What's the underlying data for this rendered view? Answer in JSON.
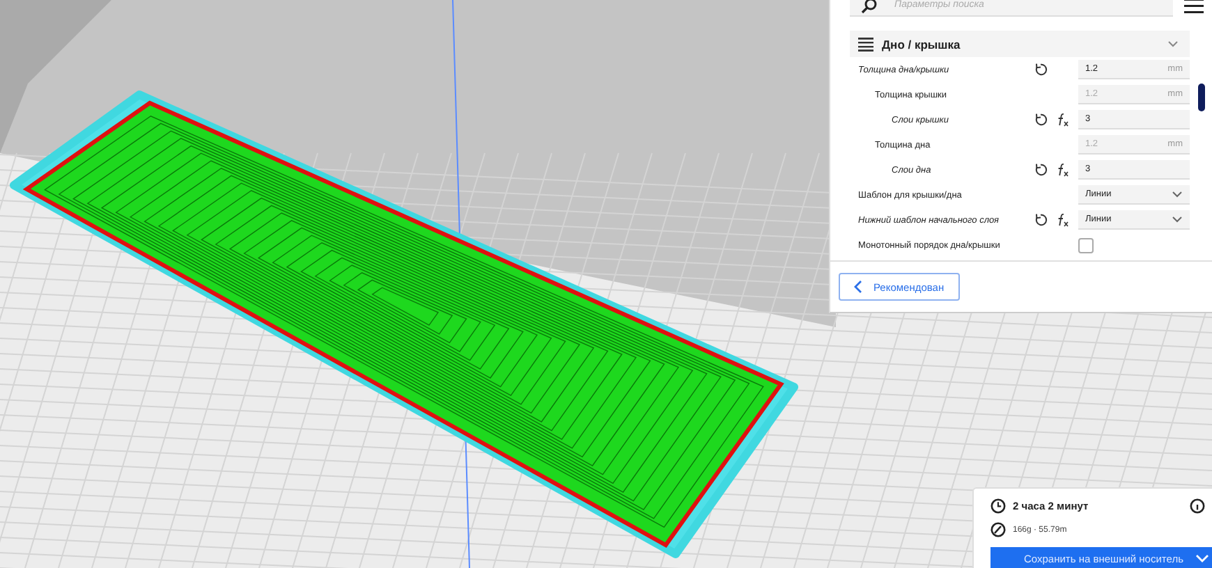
{
  "search": {
    "placeholder": "Параметры поиска"
  },
  "section": {
    "title": "Дно / крышка",
    "expanded": true
  },
  "settings": [
    {
      "label": "Толщина дна/крышки",
      "kind": "number",
      "modified": true,
      "reset": true,
      "formula": false,
      "disabled": false,
      "value": "1.2",
      "unit": "mm",
      "children": [
        {
          "label": "Толщина крышки",
          "kind": "number",
          "modified": false,
          "reset": false,
          "formula": false,
          "disabled": true,
          "value": "1.2",
          "unit": "mm",
          "children": [
            {
              "label": "Слои крышки",
              "kind": "number",
              "modified": true,
              "reset": true,
              "formula": true,
              "disabled": false,
              "value": "3"
            }
          ]
        },
        {
          "label": "Толщина дна",
          "kind": "number",
          "modified": false,
          "reset": false,
          "formula": false,
          "disabled": true,
          "value": "1.2",
          "unit": "mm",
          "children": [
            {
              "label": "Слои дна",
              "kind": "number",
              "modified": true,
              "reset": true,
              "formula": true,
              "disabled": false,
              "value": "3"
            }
          ]
        }
      ]
    },
    {
      "label": "Шаблон для крышки/дна",
      "kind": "select",
      "modified": false,
      "reset": false,
      "formula": false,
      "disabled": false,
      "value": "Линии"
    },
    {
      "label": "Нижний шаблон начального слоя",
      "kind": "select",
      "modified": true,
      "reset": true,
      "formula": true,
      "disabled": false,
      "value": "Линии"
    },
    {
      "label": "Монотонный порядок дна/крышки",
      "kind": "checkbox",
      "modified": false,
      "reset": false,
      "formula": false,
      "disabled": false,
      "checked": false
    }
  ],
  "mode_button": {
    "label": "Рекомендован"
  },
  "print_info": {
    "time": "2 часа 2 минут",
    "material": "166g · 55.79m"
  },
  "save_button": {
    "label": "Сохранить на внешний носитель"
  }
}
